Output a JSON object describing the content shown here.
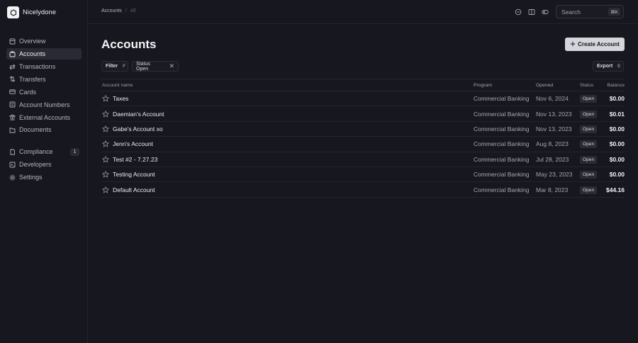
{
  "brand": {
    "name": "Nicelydone"
  },
  "sidebar": {
    "items": [
      {
        "label": "Overview",
        "icon": "overview-icon"
      },
      {
        "label": "Accounts",
        "icon": "accounts-icon",
        "active": true
      },
      {
        "label": "Transactions",
        "icon": "transactions-icon"
      },
      {
        "label": "Transfers",
        "icon": "transfers-icon"
      },
      {
        "label": "Cards",
        "icon": "cards-icon"
      },
      {
        "label": "Account Numbers",
        "icon": "account-numbers-icon"
      },
      {
        "label": "External Accounts",
        "icon": "external-accounts-icon"
      },
      {
        "label": "Documents",
        "icon": "documents-icon"
      }
    ],
    "secondary": [
      {
        "label": "Compliance",
        "icon": "compliance-icon",
        "badge": "1"
      },
      {
        "label": "Developers",
        "icon": "developers-icon"
      },
      {
        "label": "Settings",
        "icon": "settings-icon"
      }
    ]
  },
  "topbar": {
    "breadcrumb": {
      "parent": "Accounts",
      "separator": "/",
      "current": "All"
    },
    "search": {
      "placeholder": "Search",
      "shortcut": "⌘K"
    }
  },
  "main": {
    "title": "Accounts",
    "create_label": "Create Account",
    "filter": {
      "label": "Filter",
      "key": "F"
    },
    "status_chip": {
      "label": "Status Open"
    },
    "export": {
      "label": "Export",
      "key": "E"
    },
    "columns": {
      "name": "Account name",
      "program": "Program",
      "opened": "Opened",
      "status": "Status",
      "balance": "Balance"
    },
    "rows": [
      {
        "name": "Taxes",
        "program": "Commercial Banking",
        "opened": "Nov 6, 2024",
        "status": "Open",
        "balance": "$0.00"
      },
      {
        "name": "Daemian's Account",
        "program": "Commercial Banking",
        "opened": "Nov 13, 2023",
        "status": "Open",
        "balance": "$0.01"
      },
      {
        "name": "Gabe's Account xo",
        "program": "Commercial Banking",
        "opened": "Nov 13, 2023",
        "status": "Open",
        "balance": "$0.00"
      },
      {
        "name": "Jenn's Account",
        "program": "Commercial Banking",
        "opened": "Aug 8, 2023",
        "status": "Open",
        "balance": "$0.00"
      },
      {
        "name": "Test #2 - 7.27.23",
        "program": "Commercial Banking",
        "opened": "Jul 28, 2023",
        "status": "Open",
        "balance": "$0.00"
      },
      {
        "name": "Testing Account",
        "program": "Commercial Banking",
        "opened": "May 23, 2023",
        "status": "Open",
        "balance": "$0.00"
      },
      {
        "name": "Default Account",
        "program": "Commercial Banking",
        "opened": "Mar 8, 2023",
        "status": "Open",
        "balance": "$44.16"
      }
    ]
  },
  "colors": {
    "background": "#17171f",
    "active": "#2a2a34",
    "primary_button": "#d5d5dc"
  }
}
